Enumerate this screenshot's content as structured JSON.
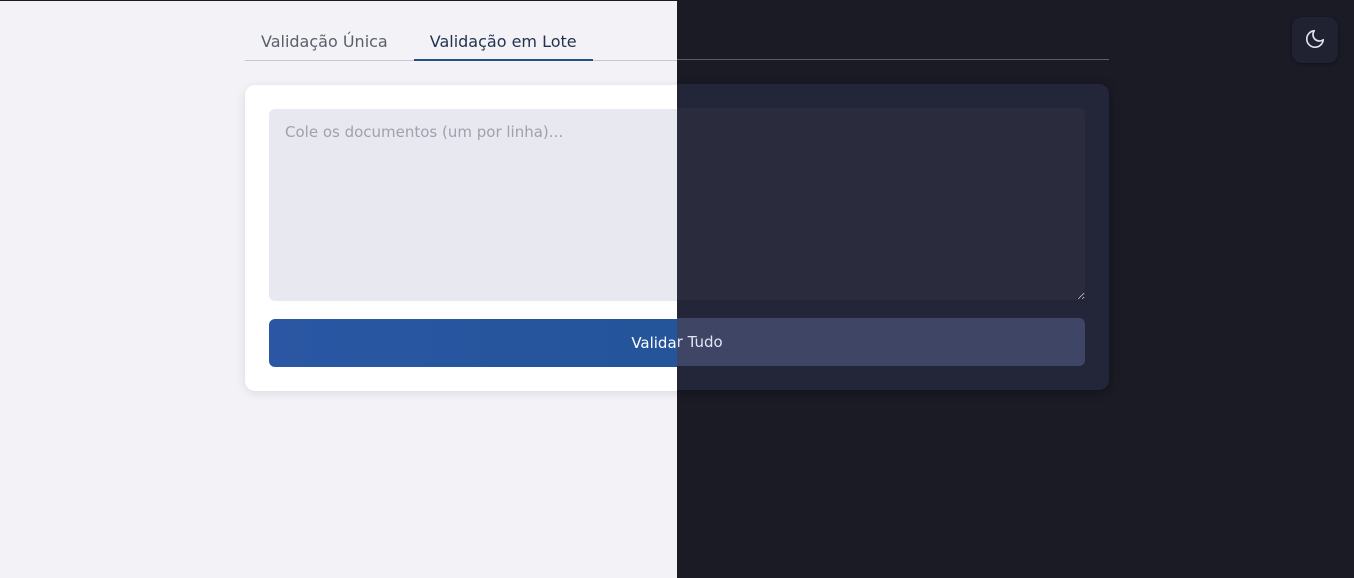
{
  "tabs": [
    {
      "label": "Validação Única",
      "active": false
    },
    {
      "label": "Validação em Lote",
      "active": true
    }
  ],
  "batch": {
    "placeholder": "Cole os documentos (um por linha)...",
    "value": ""
  },
  "actions": {
    "validate_all_label": "Validar Tudo"
  },
  "theme_toggle": {
    "icon": "moon-icon"
  },
  "colors": {
    "light_background": "#f2f2f7",
    "dark_background": "#1b1b26",
    "primary_button": "#2a56a3",
    "active_tab_underline": "#25527f"
  }
}
